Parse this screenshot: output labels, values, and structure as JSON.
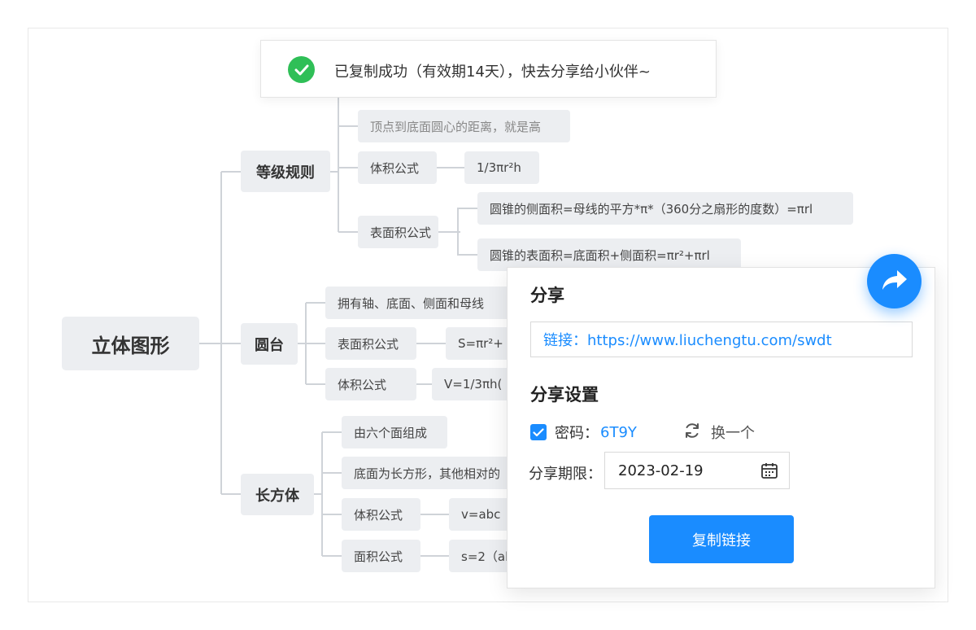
{
  "toast": {
    "message": "已复制成功（有效期14天），快去分享给小伙伴~"
  },
  "mindmap": {
    "root": "立体图形",
    "branches": [
      {
        "label": "等级规则",
        "children": [
          {
            "label": "顶点到底面圆心的距离，就是高"
          },
          {
            "label": "体积公式",
            "value": "1/3πr²h"
          },
          {
            "label": "表面积公式",
            "values": [
              "圆锥的侧面积=母线的平方*π*（360分之扇形的度数）=πrl",
              "圆锥的表面积=底面积+侧面积=πr²+πrl"
            ]
          }
        ]
      },
      {
        "label": "圆台",
        "children": [
          {
            "label": "拥有轴、底面、侧面和母线"
          },
          {
            "label": "表面积公式",
            "value": "S=πr²+"
          },
          {
            "label": "体积公式",
            "value": "V=1/3πh("
          }
        ]
      },
      {
        "label": "长方体",
        "children": [
          {
            "label": "由六个面组成"
          },
          {
            "label": "底面为长方形，其他相对的"
          },
          {
            "label": "体积公式",
            "value": "v=abc"
          },
          {
            "label": "面积公式",
            "value": "s=2（al"
          }
        ]
      }
    ]
  },
  "share_panel": {
    "title": "分享",
    "link_text": "链接：https://www.liuchengtu.com/swdt",
    "settings_title": "分享设置",
    "password_label": "密码：",
    "password_value": "6T9Y",
    "password_checked": true,
    "refresh_label": "换一个",
    "expire_label": "分享期限：",
    "expire_date": "2023-02-19",
    "copy_button": "复制链接"
  },
  "icons": {
    "toast_icon": "check-circle-icon",
    "refresh_icon": "refresh-icon",
    "calendar_icon": "calendar-icon",
    "share_icon": "share-arrow-icon"
  },
  "colors": {
    "accent": "#1a8cff",
    "success": "#2fbf57",
    "node_bg": "#eceef1",
    "line": "#cfd3d8"
  }
}
